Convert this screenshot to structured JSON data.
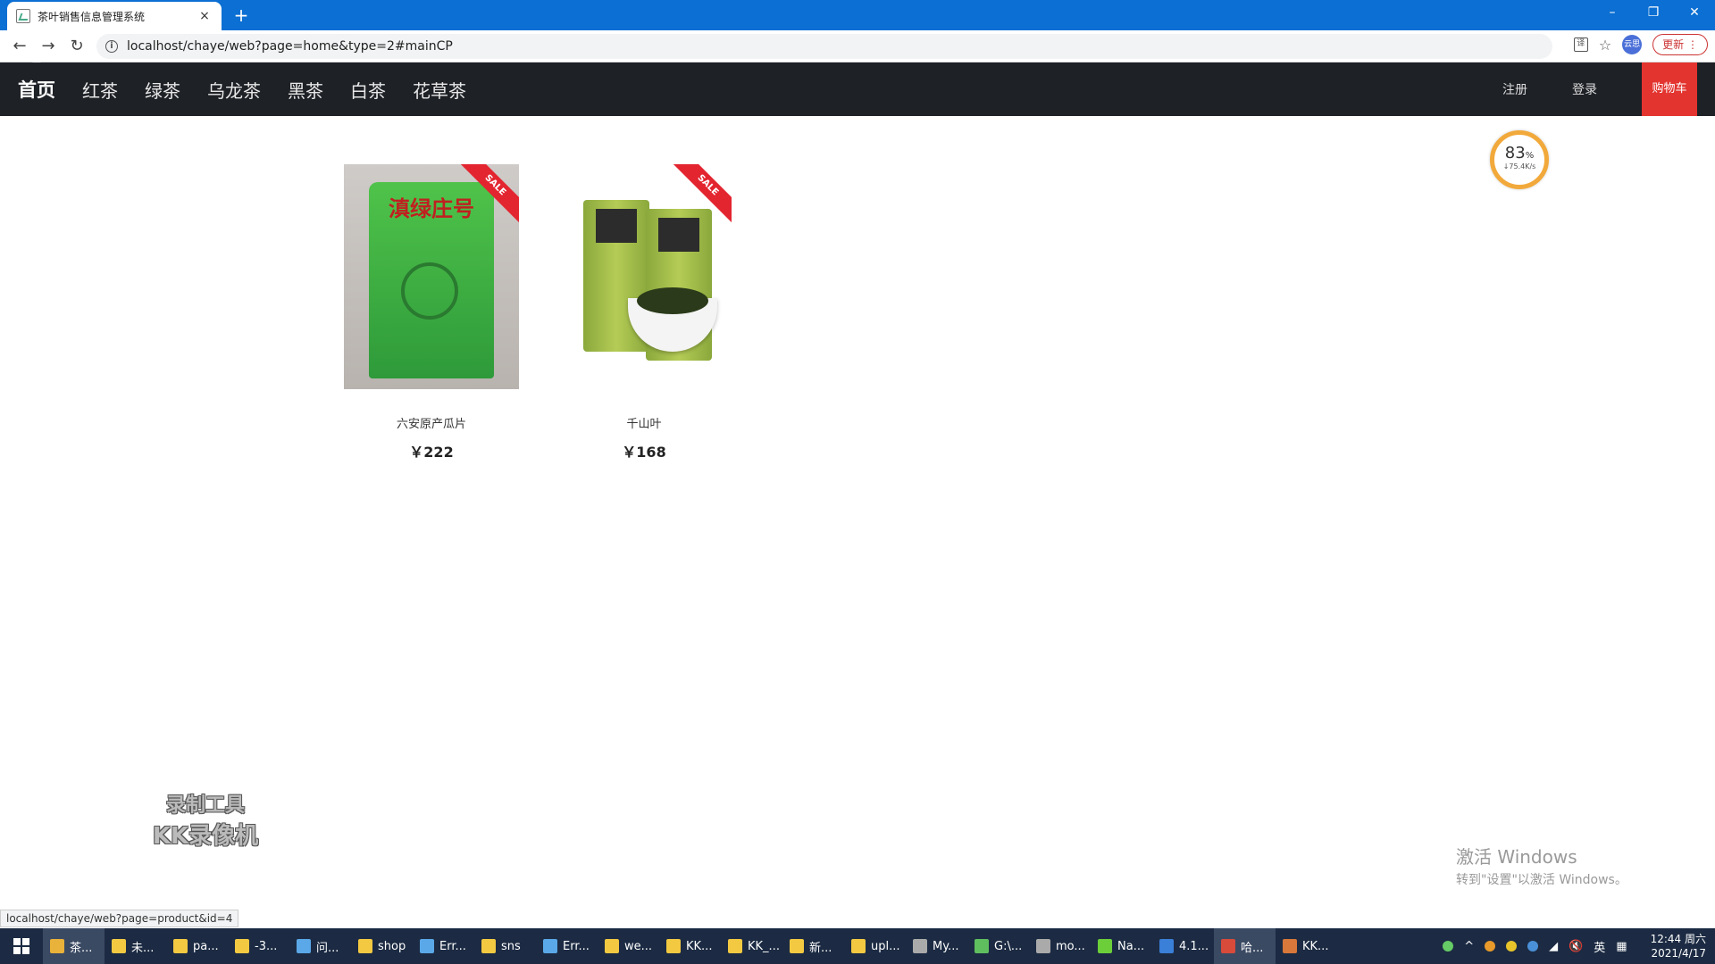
{
  "browser": {
    "tab_title": "茶叶销售信息管理系统",
    "tab_close": "×",
    "new_tab": "+",
    "url": "localhost/chaye/web?page=home&type=2#mainCP",
    "update_label": "更新",
    "profile_label": "云思",
    "status_url": "localhost/chaye/web?page=product&id=4"
  },
  "nav": {
    "items": [
      "首页",
      "红茶",
      "绿茶",
      "乌龙茶",
      "黑茶",
      "白茶",
      "花草茶"
    ],
    "register": "注册",
    "login": "登录",
    "cart": "购物车"
  },
  "products": [
    {
      "name": "六安原产瓜片",
      "price": "￥222",
      "badge": "SALE",
      "pkg_text": "滇绿庄号"
    },
    {
      "name": "千山叶",
      "price": "￥168",
      "badge": "SALE"
    }
  ],
  "gauge": {
    "percent": "83",
    "unit": "%",
    "speed": "↓75.4K/s"
  },
  "watermark": {
    "line1": "录制工具",
    "line2": "KK录像机"
  },
  "activation": {
    "line1": "激活 Windows",
    "line2": "转到\"设置\"以激活 Windows。"
  },
  "taskbar": {
    "items": [
      {
        "label": "茶...",
        "color": "#e9b23a",
        "active": true
      },
      {
        "label": "未...",
        "color": "#f3c942"
      },
      {
        "label": "pa...",
        "color": "#f3c942"
      },
      {
        "label": "-3...",
        "color": "#f3c942"
      },
      {
        "label": "问...",
        "color": "#5aa8e8"
      },
      {
        "label": "shop",
        "color": "#f3c942"
      },
      {
        "label": "Err...",
        "color": "#5aa8e8"
      },
      {
        "label": "sns",
        "color": "#f3c942"
      },
      {
        "label": "Err...",
        "color": "#5aa8e8"
      },
      {
        "label": "we...",
        "color": "#f3c942"
      },
      {
        "label": "KK...",
        "color": "#f3c942"
      },
      {
        "label": "KK_...",
        "color": "#f3c942"
      },
      {
        "label": "新...",
        "color": "#f3c942"
      },
      {
        "label": "upl...",
        "color": "#f3c942"
      },
      {
        "label": "My...",
        "color": "#aaaaaa"
      },
      {
        "label": "G:\\...",
        "color": "#5fbf5f"
      },
      {
        "label": "mo...",
        "color": "#aaaaaa"
      },
      {
        "label": "Na...",
        "color": "#6ccf3a"
      },
      {
        "label": "4.1...",
        "color": "#3a7fd8"
      },
      {
        "label": "哈...",
        "color": "#d84a3a",
        "active": true
      },
      {
        "label": "KK...",
        "color": "#d8783a"
      }
    ],
    "ime": "英",
    "time": "12:44 周六",
    "date": "2021/4/17"
  }
}
